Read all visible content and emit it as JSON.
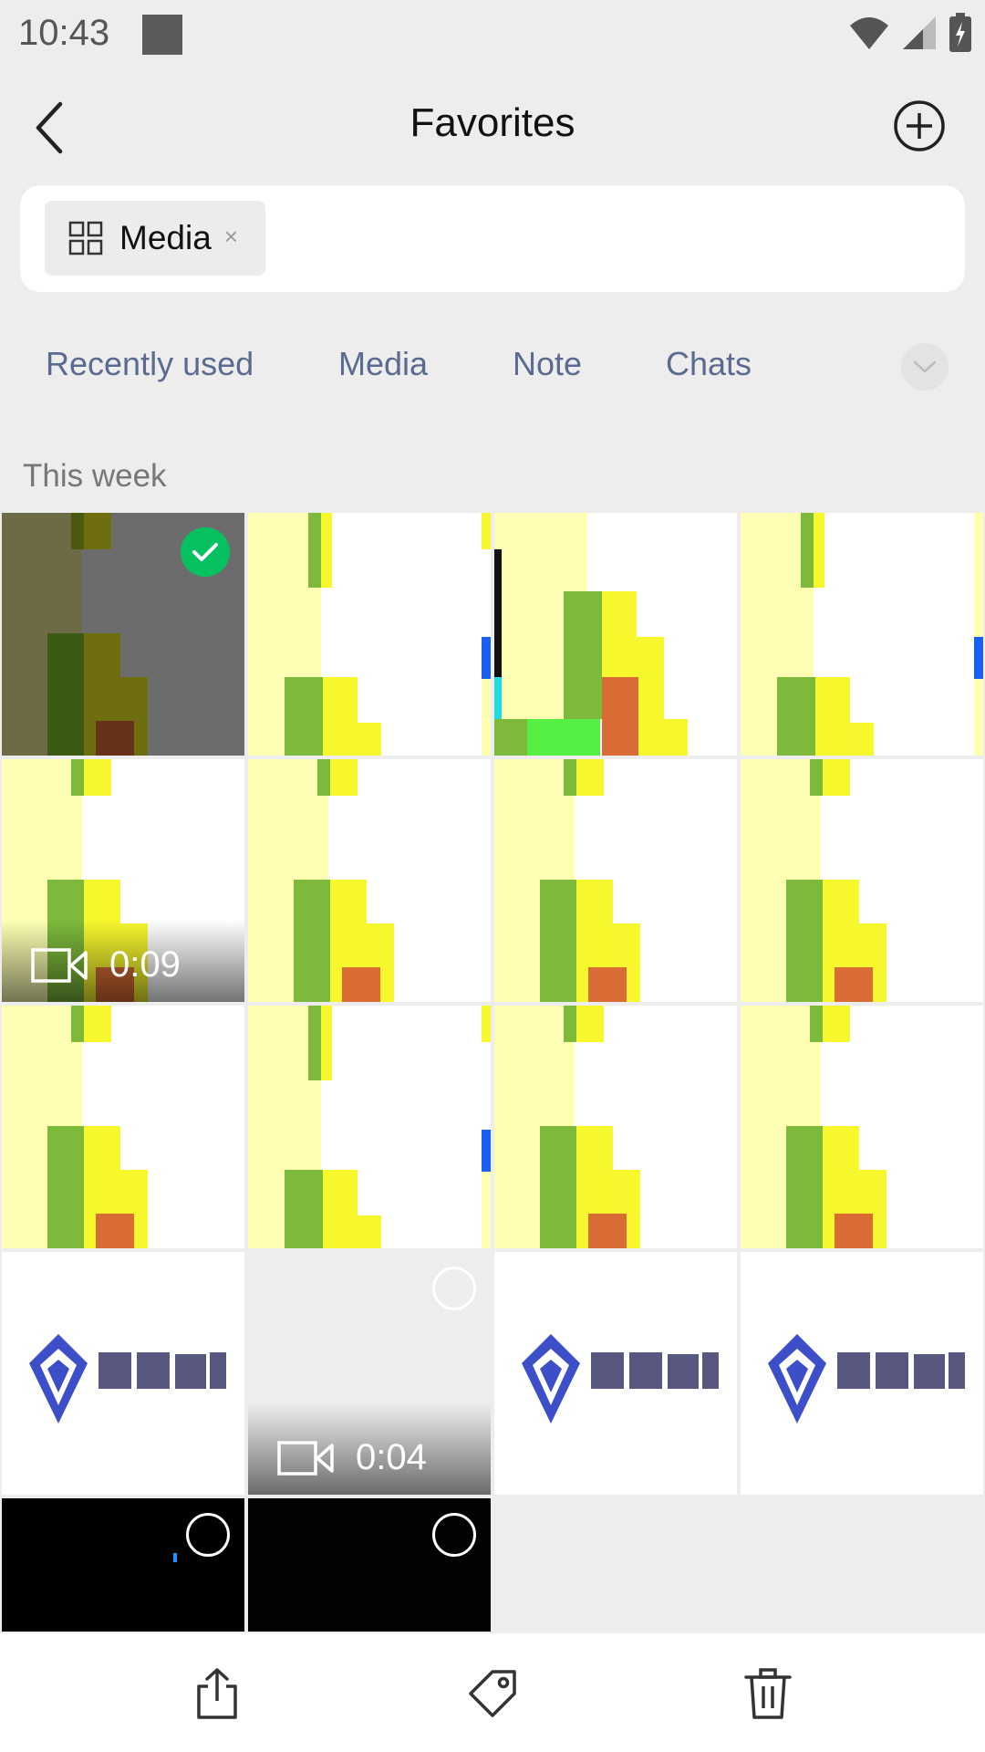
{
  "status": {
    "time": "10:43"
  },
  "nav": {
    "title": "Favorites"
  },
  "search": {
    "chip_label": "Media",
    "chip_close": "×"
  },
  "tabs": [
    {
      "label": "Recently used"
    },
    {
      "label": "Media"
    },
    {
      "label": "Note"
    },
    {
      "label": "Chats"
    }
  ],
  "section": {
    "label": "This week"
  },
  "media": {
    "video1_duration": "0:09",
    "video2_duration": "0:04"
  },
  "colors": {
    "accent_green": "#07c160",
    "tab_text": "#5b6b90",
    "background": "#ededed"
  },
  "icons": {
    "back": "chevron-left-icon",
    "add": "plus-circle-icon",
    "chip": "grid-icon",
    "more": "chevron-down-icon",
    "share": "share-icon",
    "tag": "tag-icon",
    "delete": "trash-icon",
    "video": "video-camera-icon"
  }
}
